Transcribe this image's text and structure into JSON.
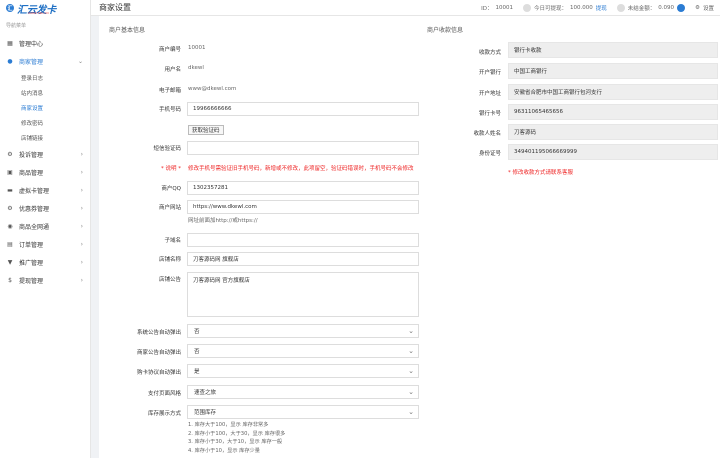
{
  "app": {
    "logo_text": "汇云发卡",
    "logo_sub": "WWW.39K.CN",
    "logo_mark": "汇"
  },
  "sidebar": {
    "nav_title": "导航菜单",
    "items": [
      {
        "label": "管理中心",
        "icon": "▦",
        "arrow": ""
      },
      {
        "label": "商家管理",
        "icon": "●",
        "arrow": "⌄"
      },
      {
        "label": "投诉管理",
        "icon": "⚙",
        "arrow": "›"
      },
      {
        "label": "商品管理",
        "icon": "▣",
        "arrow": "›"
      },
      {
        "label": "虚拟卡管理",
        "icon": "▬",
        "arrow": "›"
      },
      {
        "label": "优惠券管理",
        "icon": "⚙",
        "arrow": "›"
      },
      {
        "label": "商品全网通",
        "icon": "◉",
        "arrow": "›"
      },
      {
        "label": "订单管理",
        "icon": "▤",
        "arrow": "›"
      },
      {
        "label": "推广管理",
        "icon": "▼",
        "arrow": "›"
      },
      {
        "label": "提现管理",
        "icon": "$",
        "arrow": "›"
      }
    ],
    "sub_items": [
      "登录日志",
      "站内消息",
      "商家设置",
      "修改密码",
      "店铺链接"
    ]
  },
  "header": {
    "title": "商家设置",
    "id_label": "ID：",
    "id_value": "10001",
    "today_label": "今日可提现：",
    "today_value": "100.000",
    "withdraw": "提现",
    "unsettled_label": "未结金额：",
    "unsettled_value": "0.090",
    "settings_label": "设置"
  },
  "basic": {
    "section": "商户基本信息",
    "merchant_no_label": "商户编号",
    "merchant_no": "10001",
    "username_label": "用户名",
    "username": "dkewl",
    "email_label": "电子邮箱",
    "email": "www@dkewl.com",
    "phone_label": "手机号码",
    "phone": "19966666666",
    "sms_button": "获取验证码",
    "sms_label": "短信验证码",
    "sms_value": "",
    "warn_label": "* 说明 *",
    "warn_text": "修改手机号需验证旧手机号码，新增或不修改，此项留空，验证码错误时，手机号码不会修改",
    "qq_label": "商户QQ",
    "qq": "1302357281",
    "site_label": "商户网站",
    "site": "https://www.dkewl.com",
    "site_hint": "网址前面加http://或https://",
    "subdomain_label": "子域名",
    "subdomain": "",
    "shop_name_label": "店铺名称",
    "shop_name": "刀客源码网 旗舰店",
    "notice_label": "店铺公告",
    "notice": "刀客源码网 官方旗舰店",
    "sys_popup_label": "系统公告自动弹出",
    "sys_popup": "否",
    "shop_popup_label": "商家公告自动弹出",
    "shop_popup": "否",
    "buy_popup_label": "购卡协议自动弹出",
    "buy_popup": "是",
    "pay_style_label": "支付页面风格",
    "pay_style": "速查之旅",
    "stock_label": "库存展示方式",
    "stock": "范围库存",
    "stock_notes": [
      "1. 库存大于100，显示 库存非常多",
      "2. 库存小于100，大于30，显示 库存很多",
      "3. 库存小于30，大于10，显示 库存一般",
      "4. 库存小于10，显示 库存少量"
    ]
  },
  "payment": {
    "section": "商户收款信息",
    "method_label": "收款方式",
    "method": "银行卡收款",
    "bank_label": "开户银行",
    "bank": "中国工商银行",
    "branch_label": "开户地址",
    "branch": "安徽省合肥市中国工商银行包河支行",
    "card_label": "银行卡号",
    "card": "96311065465656",
    "name_label": "收款人姓名",
    "name": "刀客源码",
    "idcard_label": "身份证号",
    "idcard": "349401195066669999",
    "note": "* 修改收款方式请联系客服"
  }
}
